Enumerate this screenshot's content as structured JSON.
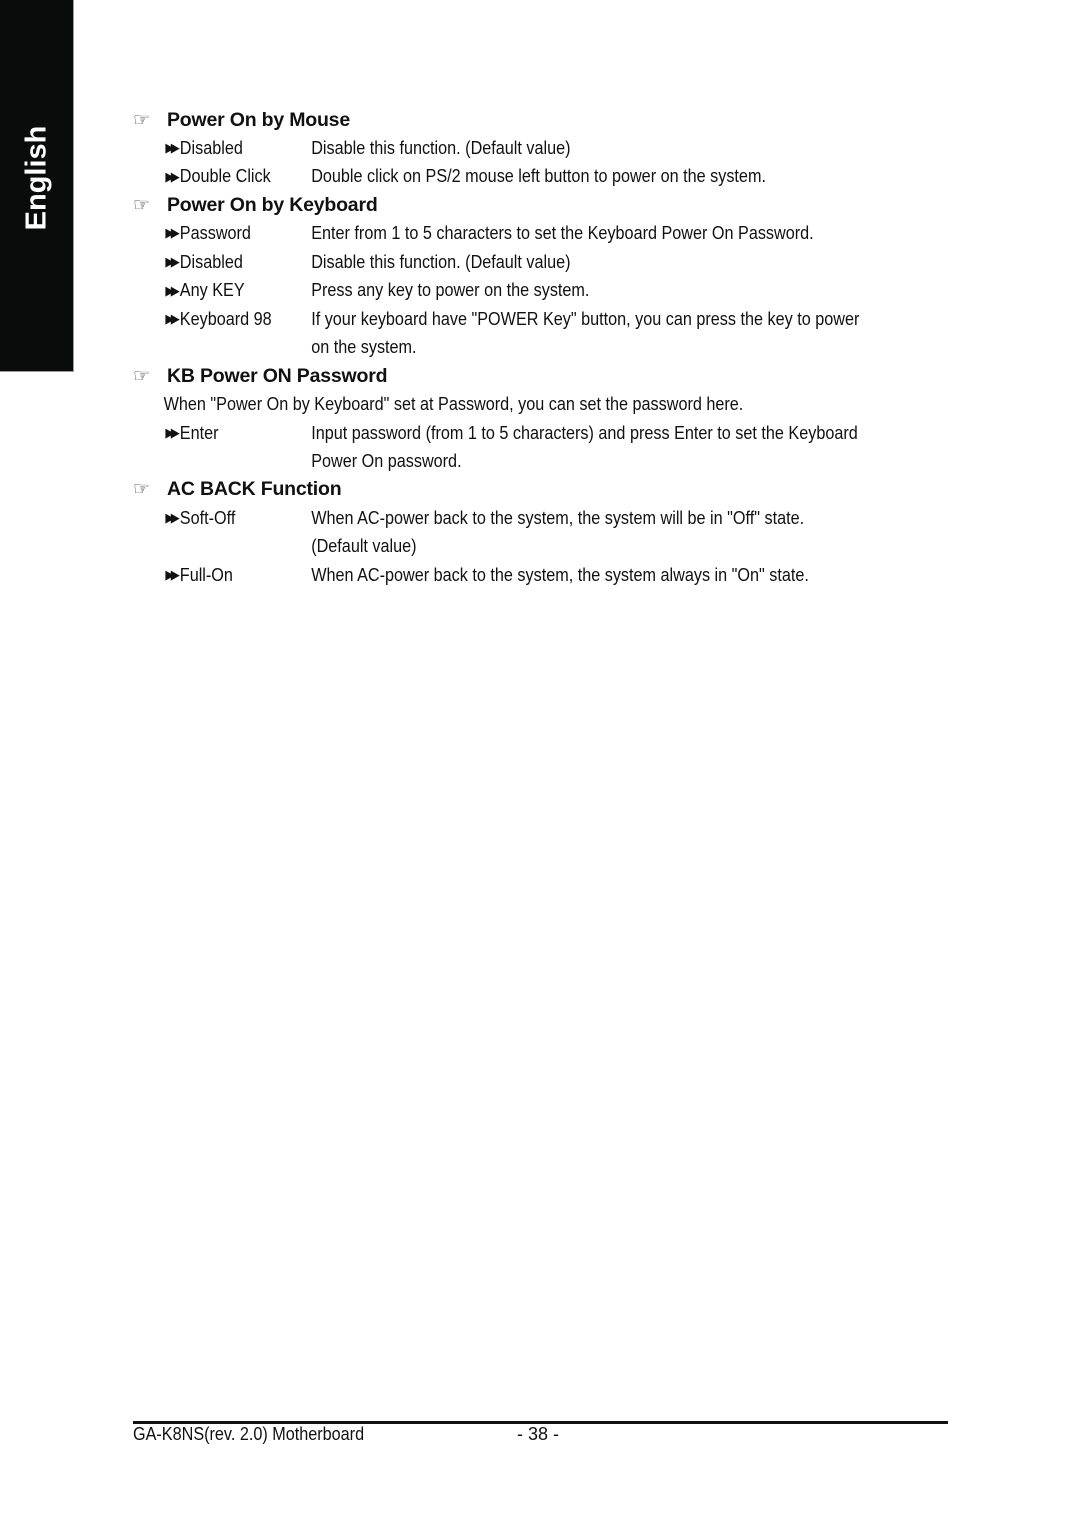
{
  "side_tab": {
    "label": "English"
  },
  "sections": [
    {
      "title": "Power On by Mouse",
      "intro": null,
      "options": [
        {
          "name": "Disabled",
          "lines": [
            "Disable this function. (Default value)"
          ]
        },
        {
          "name": "Double Click",
          "lines": [
            "Double click on PS/2 mouse left button to power on the system."
          ]
        }
      ]
    },
    {
      "title": "Power On by Keyboard",
      "intro": null,
      "options": [
        {
          "name": "Password",
          "lines": [
            "Enter from 1 to 5 characters to set the Keyboard Power On Password."
          ]
        },
        {
          "name": "Disabled",
          "lines": [
            "Disable this function. (Default value)"
          ]
        },
        {
          "name": "Any KEY",
          "lines": [
            "Press any key to power on the system."
          ]
        },
        {
          "name": "Keyboard 98",
          "lines": [
            "If your keyboard have \"POWER Key\" button, you can press the key to power",
            "on the system."
          ]
        }
      ]
    },
    {
      "title": "KB Power ON Password",
      "intro": "When \"Power On by Keyboard\" set at Password, you can set the password here.",
      "options": [
        {
          "name": "Enter",
          "lines": [
            "Input password (from 1 to 5 characters) and press Enter to set the Keyboard",
            "Power On password."
          ]
        }
      ]
    },
    {
      "title": "AC BACK Function",
      "intro": null,
      "options": [
        {
          "name": "Soft-Off",
          "lines": [
            "When AC-power back to the system, the system will be in \"Off\" state.",
            "(Default value)"
          ]
        },
        {
          "name": "Full-On",
          "lines": [
            "When AC-power back to the system, the system always in \"On\" state."
          ]
        }
      ]
    }
  ],
  "icons": {
    "section": "hand-pointing-right-icon",
    "option": "double-arrow-right-icon"
  },
  "footer": {
    "model": "GA-K8NS(rev. 2.0) Motherboard",
    "page": "- 38 -"
  }
}
